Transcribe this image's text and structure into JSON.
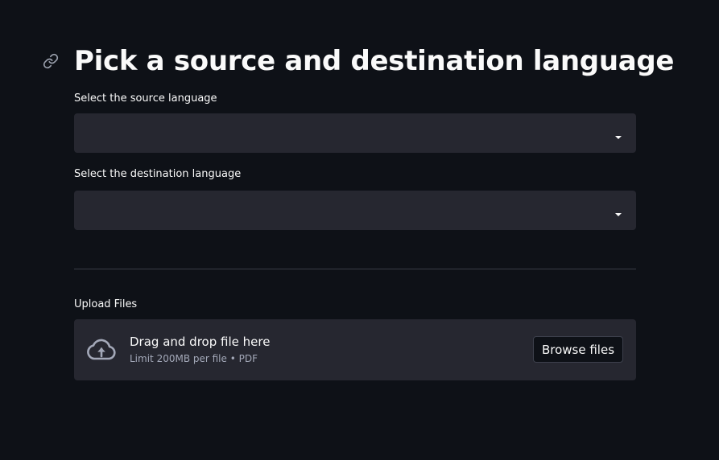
{
  "header": {
    "title": "Pick a source and destination language",
    "anchor_icon": "link-icon"
  },
  "source_language": {
    "label": "Select the source language",
    "selected_value": "",
    "icon": "chevron-down-icon"
  },
  "destination_language": {
    "label": "Select the destination language",
    "selected_value": "",
    "icon": "chevron-down-icon"
  },
  "upload": {
    "label": "Upload Files",
    "dropzone_title": "Drag and drop file here",
    "dropzone_hint": "Limit 200MB per file • PDF",
    "browse_label": "Browse files",
    "icon": "cloud-upload-icon"
  },
  "colors": {
    "background": "#0e1117",
    "widget_background": "#262730",
    "text": "#fafafa",
    "muted_text": "#a3a8b8"
  }
}
